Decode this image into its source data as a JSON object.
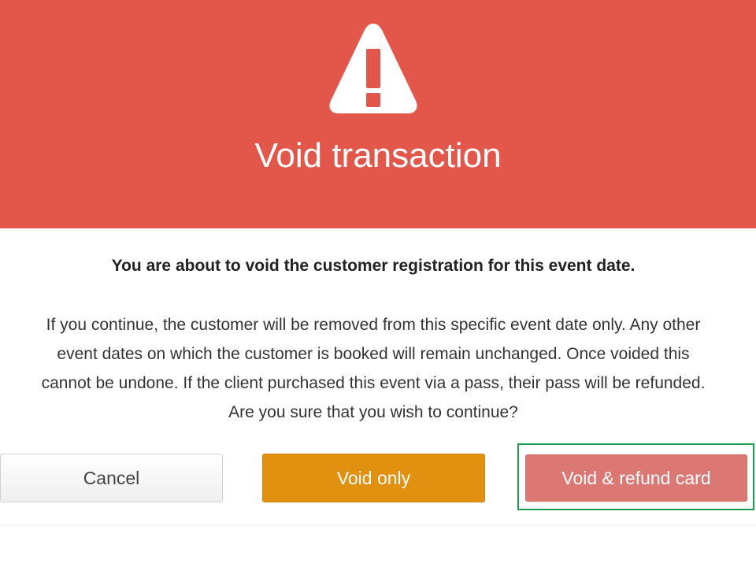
{
  "dialog": {
    "icon": "warning-triangle-icon",
    "title": "Void transaction",
    "lead": "You are about to void the customer registration for this event date.",
    "body_lines": [
      "If you continue, the customer will be removed from this specific event date only. Any other",
      "event dates on which the customer is booked will remain unchanged. Once voided this",
      "cannot be undone. If the client purchased this event via a pass, their pass will be refunded.",
      "Are you sure that you wish to continue?"
    ]
  },
  "buttons": {
    "cancel": "Cancel",
    "void_only": "Void only",
    "void_refund": "Void & refund card"
  },
  "colors": {
    "header": "#e3574b",
    "void_only": "#e1900f",
    "void_refund": "#dc7873",
    "highlight": "#1a9b4f"
  }
}
